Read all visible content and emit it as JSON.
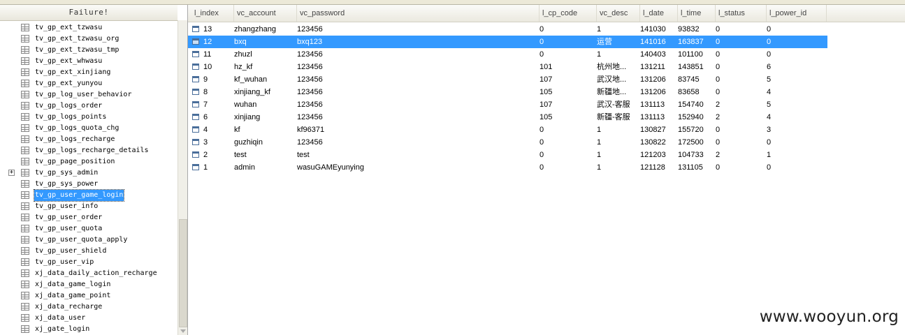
{
  "tree": {
    "header": "Failure!",
    "items": [
      {
        "label": "tv_gp_ext_tzwasu"
      },
      {
        "label": "tv_gp_ext_tzwasu_org"
      },
      {
        "label": "tv_gp_ext_tzwasu_tmp"
      },
      {
        "label": "tv_gp_ext_whwasu"
      },
      {
        "label": "tv_gp_ext_xinjiang"
      },
      {
        "label": "tv_gp_ext_yunyou"
      },
      {
        "label": "tv_gp_log_user_behavior"
      },
      {
        "label": "tv_gp_logs_order"
      },
      {
        "label": "tv_gp_logs_points"
      },
      {
        "label": "tv_gp_logs_quota_chg"
      },
      {
        "label": "tv_gp_logs_recharge"
      },
      {
        "label": "tv_gp_logs_recharge_details"
      },
      {
        "label": "tv_gp_page_position"
      },
      {
        "label": "tv_gp_sys_admin",
        "expander": "+"
      },
      {
        "label": "tv_gp_sys_power"
      },
      {
        "label": "tv_gp_user_game_login",
        "selected": true
      },
      {
        "label": "tv_gp_user_info"
      },
      {
        "label": "tv_gp_user_order"
      },
      {
        "label": "tv_gp_user_quota"
      },
      {
        "label": "tv_gp_user_quota_apply"
      },
      {
        "label": "tv_gp_user_shield"
      },
      {
        "label": "tv_gp_user_vip"
      },
      {
        "label": "xj_data_daily_action_recharge"
      },
      {
        "label": "xj_data_game_login"
      },
      {
        "label": "xj_data_game_point"
      },
      {
        "label": "xj_data_recharge"
      },
      {
        "label": "xj_data_user"
      },
      {
        "label": "xj_gate_login"
      }
    ]
  },
  "grid": {
    "columns": [
      "l_index",
      "vc_account",
      "vc_password",
      "l_cp_code",
      "vc_desc",
      "l_date",
      "l_time",
      "l_status",
      "l_power_id"
    ],
    "rows": [
      [
        "13",
        "zhangzhang",
        "123456",
        "0",
        "1",
        "141030",
        "93832",
        "0",
        "0"
      ],
      [
        "12",
        "bxq",
        "bxq123",
        "0",
        "运营",
        "141016",
        "163837",
        "0",
        "0"
      ],
      [
        "11",
        "zhuzl",
        "123456",
        "0",
        "1",
        "140403",
        "101100",
        "0",
        "0"
      ],
      [
        "10",
        "hz_kf",
        "123456",
        "101",
        "杭州地...",
        "131211",
        "143851",
        "0",
        "6"
      ],
      [
        "9",
        "kf_wuhan",
        "123456",
        "107",
        "武汉地...",
        "131206",
        "83745",
        "0",
        "5"
      ],
      [
        "8",
        "xinjiang_kf",
        "123456",
        "105",
        "新疆地...",
        "131206",
        "83658",
        "0",
        "4"
      ],
      [
        "7",
        "wuhan",
        "123456",
        "107",
        "武汉-客服",
        "131113",
        "154740",
        "2",
        "5"
      ],
      [
        "6",
        "xinjiang",
        "123456",
        "105",
        "新疆-客服",
        "131113",
        "152940",
        "2",
        "4"
      ],
      [
        "4",
        "kf",
        "kf96371",
        "0",
        "1",
        "130827",
        "155720",
        "0",
        "3"
      ],
      [
        "3",
        "guzhiqin",
        "123456",
        "0",
        "1",
        "130822",
        "172500",
        "0",
        "0"
      ],
      [
        "2",
        "test",
        "test",
        "0",
        "1",
        "121203",
        "104733",
        "2",
        "1"
      ],
      [
        "1",
        "admin",
        "wasuGAMEyunying",
        "0",
        "1",
        "121128",
        "131105",
        "0",
        "0"
      ]
    ],
    "selected_row": 1
  },
  "watermark": "www.wooyun.org"
}
